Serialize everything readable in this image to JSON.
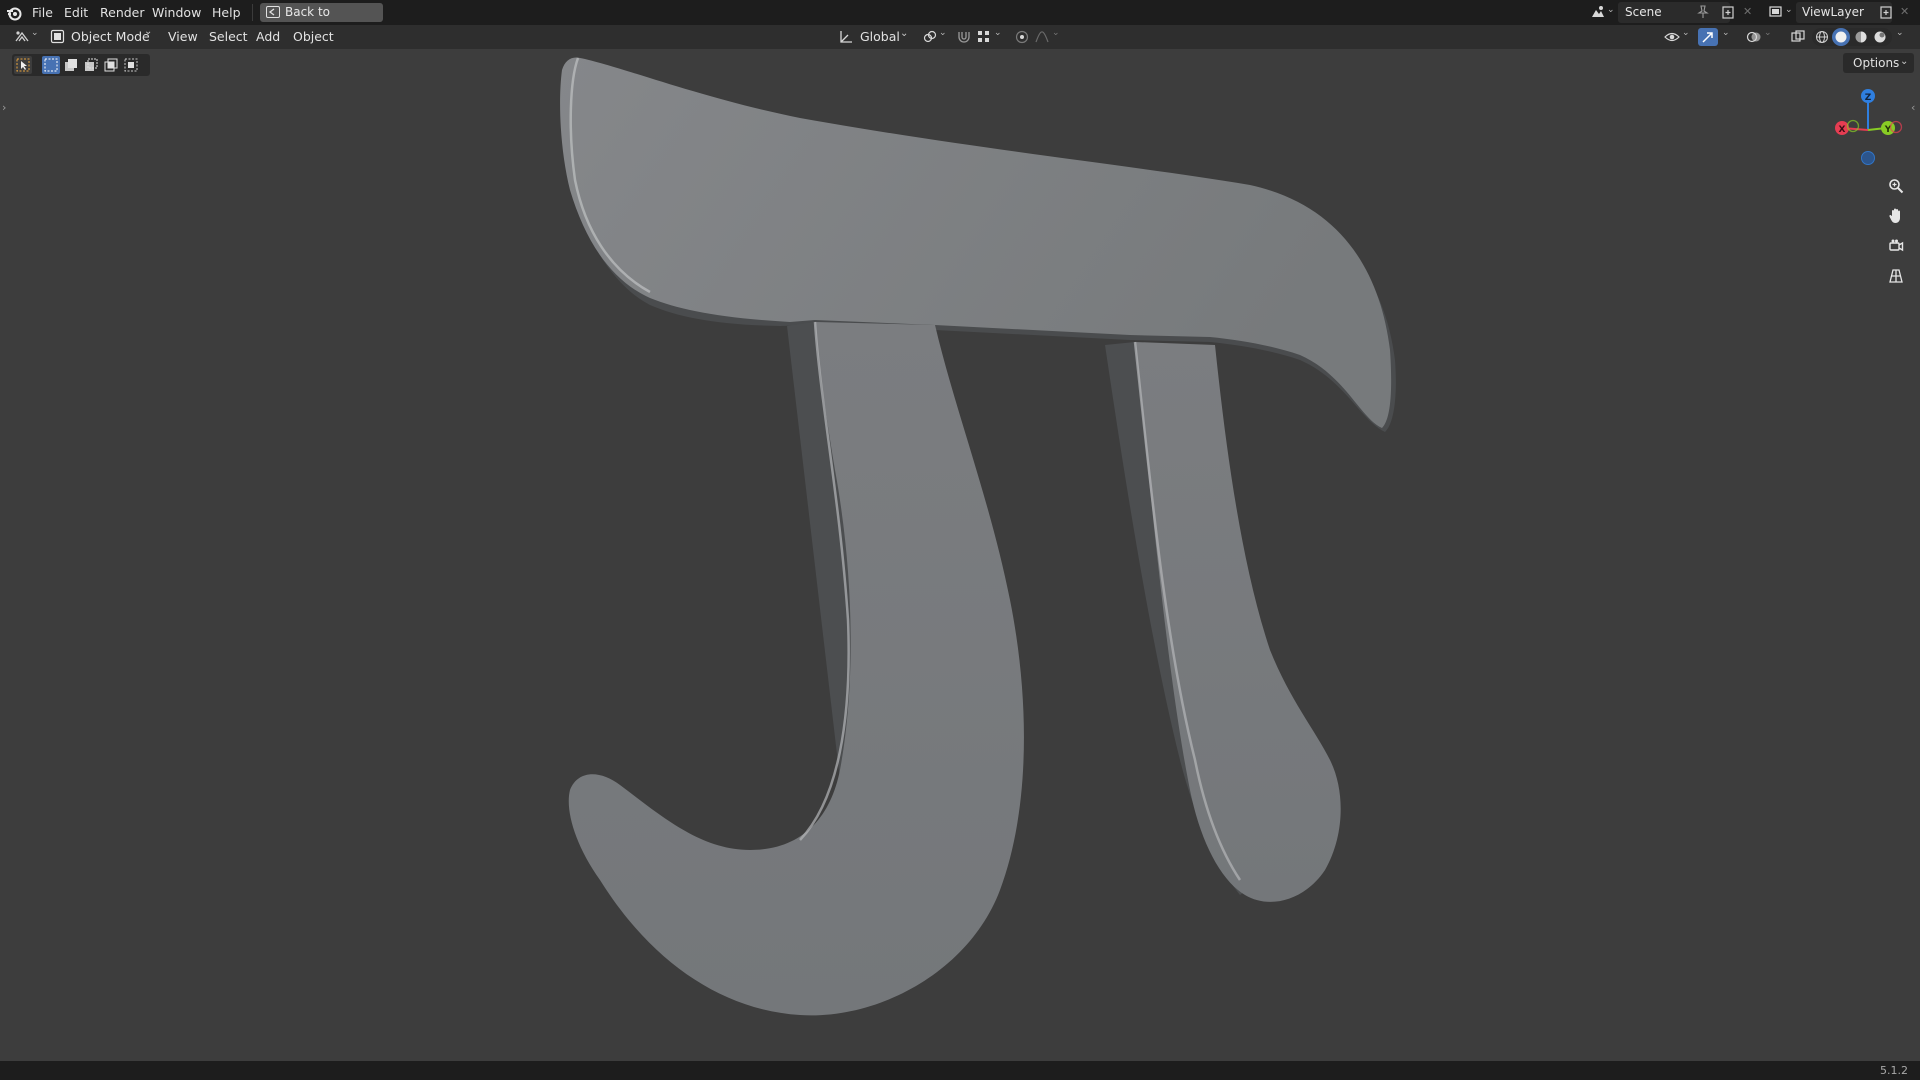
{
  "menubar": {
    "items": [
      "File",
      "Edit",
      "Render",
      "Window",
      "Help"
    ],
    "back_button": "Back to Previous",
    "scene_name": "Scene",
    "view_layer": "ViewLayer"
  },
  "header": {
    "mode": "Object Mode",
    "menus": [
      "View",
      "Select",
      "Add",
      "Object"
    ],
    "orientation": "Global",
    "options_label": "Options"
  },
  "gizmo": {
    "axes": [
      "Z",
      "X",
      "Y"
    ],
    "colors": {
      "x": "#e53d52",
      "y": "#88cc25",
      "z": "#2f7fe0"
    }
  },
  "navigation_icons": [
    "zoom-icon",
    "pan-hand-icon",
    "camera-icon",
    "grid-perspective-icon"
  ],
  "status": {
    "version": "5.1.2"
  },
  "colors": {
    "background": "#3d3d3d",
    "header": "#2e2e2e",
    "topbar": "#1d1d1d",
    "active_blue": "#4772b3",
    "object_grey": "#7a7c7e"
  }
}
